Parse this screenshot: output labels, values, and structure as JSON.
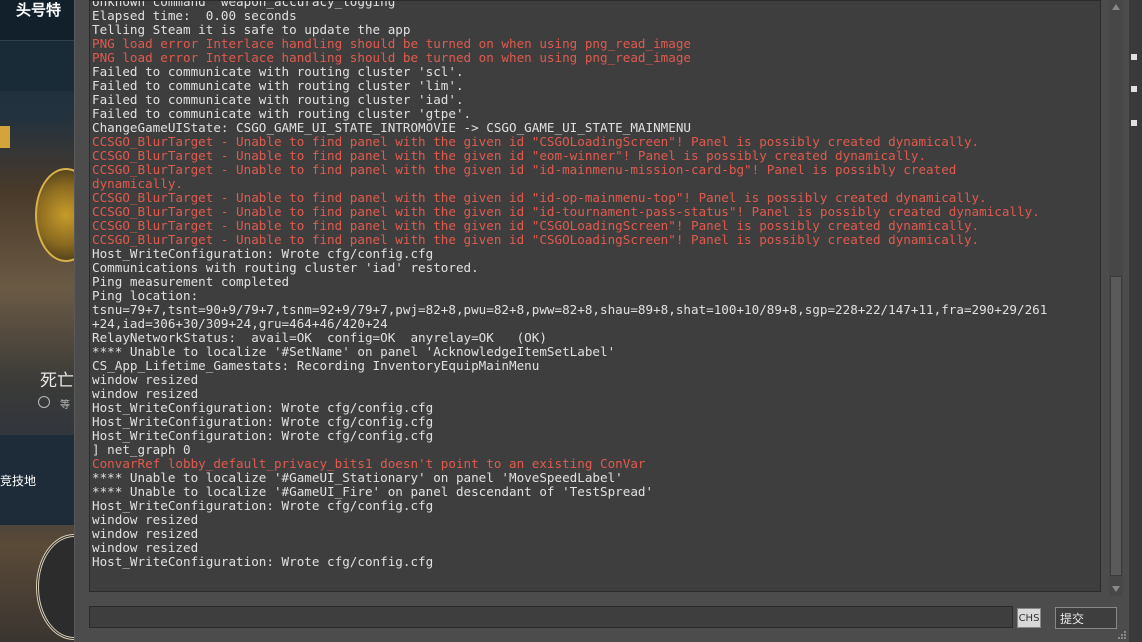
{
  "game": {
    "title": "头号特",
    "card_title": "死亡",
    "clock_text": "等",
    "side_label": "竞技地"
  },
  "console": {
    "lines": [
      {
        "text": "Unknown command \"weapon_accuracy_logging\"",
        "type": "normal"
      },
      {
        "text": "Elapsed time:  0.00 seconds",
        "type": "normal"
      },
      {
        "text": "Telling Steam it is safe to update the app",
        "type": "normal"
      },
      {
        "text": "PNG load error Interlace handling should be turned on when using png_read_image",
        "type": "error"
      },
      {
        "text": "PNG load error Interlace handling should be turned on when using png_read_image",
        "type": "error"
      },
      {
        "text": "Failed to communicate with routing cluster 'scl'.",
        "type": "normal"
      },
      {
        "text": "Failed to communicate with routing cluster 'lim'.",
        "type": "normal"
      },
      {
        "text": "Failed to communicate with routing cluster 'iad'.",
        "type": "normal"
      },
      {
        "text": "Failed to communicate with routing cluster 'gtpe'.",
        "type": "normal"
      },
      {
        "text": "ChangeGameUIState: CSGO_GAME_UI_STATE_INTROMOVIE -> CSGO_GAME_UI_STATE_MAINMENU",
        "type": "normal"
      },
      {
        "text": "CCSGO_BlurTarget - Unable to find panel with the given id \"CSGOLoadingScreen\"! Panel is possibly created dynamically.",
        "type": "error"
      },
      {
        "text": "CCSGO_BlurTarget - Unable to find panel with the given id \"eom-winner\"! Panel is possibly created dynamically.",
        "type": "error"
      },
      {
        "text": "CCSGO_BlurTarget - Unable to find panel with the given id \"id-mainmenu-mission-card-bg\"! Panel is possibly created",
        "type": "error"
      },
      {
        "text": "dynamically.",
        "type": "error"
      },
      {
        "text": "CCSGO_BlurTarget - Unable to find panel with the given id \"id-op-mainmenu-top\"! Panel is possibly created dynamically.",
        "type": "error"
      },
      {
        "text": "CCSGO_BlurTarget - Unable to find panel with the given id \"id-tournament-pass-status\"! Panel is possibly created dynamically.",
        "type": "error"
      },
      {
        "text": "CCSGO_BlurTarget - Unable to find panel with the given id \"CSGOLoadingScreen\"! Panel is possibly created dynamically.",
        "type": "error"
      },
      {
        "text": "CCSGO_BlurTarget - Unable to find panel with the given id \"CSGOLoadingScreen\"! Panel is possibly created dynamically.",
        "type": "error"
      },
      {
        "text": "Host_WriteConfiguration: Wrote cfg/config.cfg",
        "type": "normal"
      },
      {
        "text": "Communications with routing cluster 'iad' restored.",
        "type": "normal"
      },
      {
        "text": "Ping measurement completed",
        "type": "normal"
      },
      {
        "text": "Ping location:",
        "type": "normal"
      },
      {
        "text": "tsnu=79+7,tsnt=90+9/79+7,tsnm=92+9/79+7,pwj=82+8,pwu=82+8,pww=82+8,shau=89+8,shat=100+10/89+8,sgp=228+22/147+11,fra=290+29/261",
        "type": "normal"
      },
      {
        "text": "+24,iad=306+30/309+24,gru=464+46/420+24",
        "type": "normal"
      },
      {
        "text": "RelayNetworkStatus:  avail=OK  config=OK  anyrelay=OK   (OK)",
        "type": "normal"
      },
      {
        "text": "**** Unable to localize '#SetName' on panel 'AcknowledgeItemSetLabel'",
        "type": "normal"
      },
      {
        "text": "CS_App_Lifetime_Gamestats: Recording InventoryEquipMainMenu",
        "type": "normal"
      },
      {
        "text": "window resized",
        "type": "normal"
      },
      {
        "text": "window resized",
        "type": "normal"
      },
      {
        "text": "Host_WriteConfiguration: Wrote cfg/config.cfg",
        "type": "normal"
      },
      {
        "text": "Host_WriteConfiguration: Wrote cfg/config.cfg",
        "type": "normal"
      },
      {
        "text": "Host_WriteConfiguration: Wrote cfg/config.cfg",
        "type": "normal"
      },
      {
        "text": "] net_graph 0",
        "type": "normal"
      },
      {
        "text": "ConvarRef lobby_default_privacy_bits1 doesn't point to an existing ConVar",
        "type": "error"
      },
      {
        "text": "**** Unable to localize '#GameUI_Stationary' on panel 'MoveSpeedLabel'",
        "type": "normal"
      },
      {
        "text": "**** Unable to localize '#GameUI_Fire' on panel descendant of 'TestSpread'",
        "type": "normal"
      },
      {
        "text": "Host_WriteConfiguration: Wrote cfg/config.cfg",
        "type": "normal"
      },
      {
        "text": "window resized",
        "type": "normal"
      },
      {
        "text": "window resized",
        "type": "normal"
      },
      {
        "text": "window resized",
        "type": "normal"
      },
      {
        "text": "Host_WriteConfiguration: Wrote cfg/config.cfg",
        "type": "normal"
      }
    ],
    "input_value": "",
    "ime_label": "CHS",
    "submit_label": "提交"
  },
  "colors": {
    "normal_text": "#e0e0e0",
    "error_text": "#e05a4e",
    "console_bg": "#3e3e3e",
    "frame_bg": "#4c4c4c"
  }
}
